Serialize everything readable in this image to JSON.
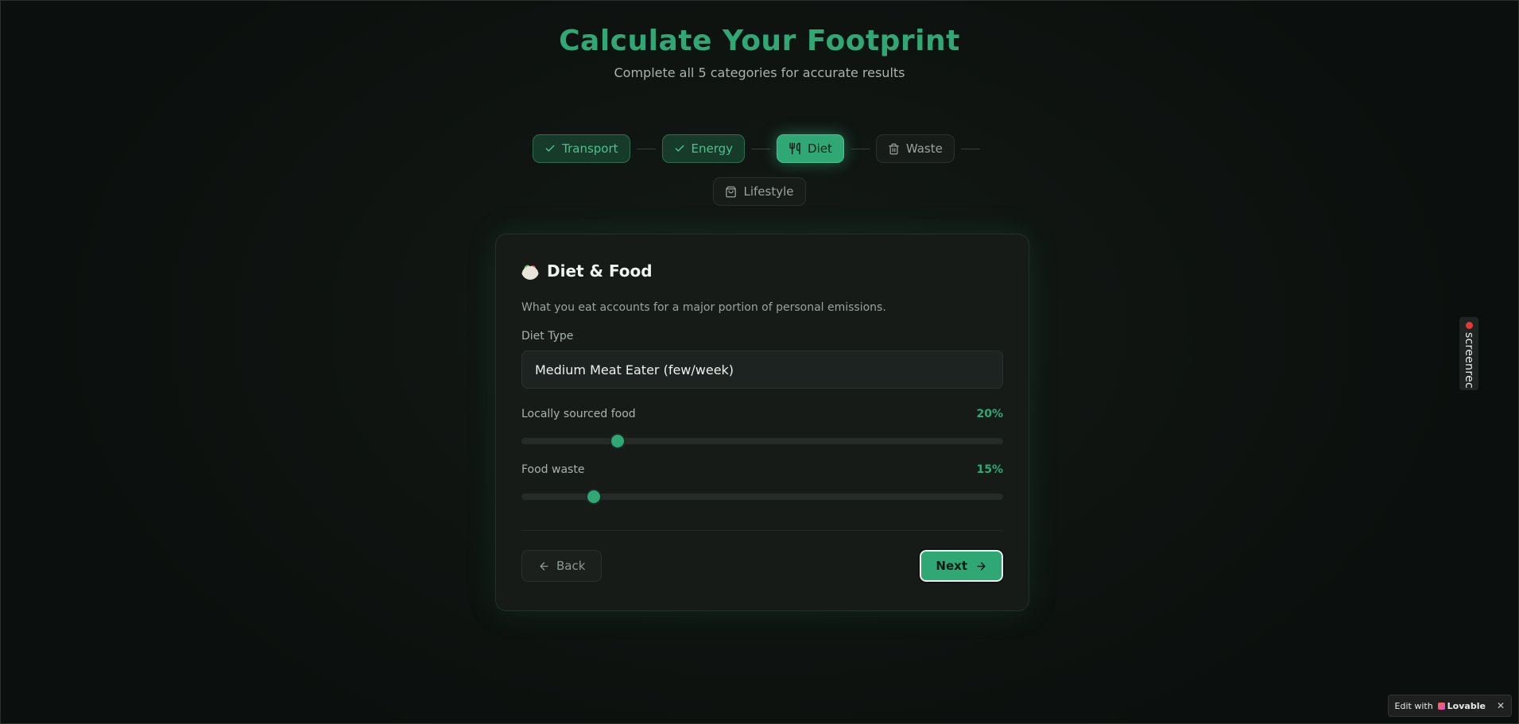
{
  "header": {
    "title": "Calculate Your Footprint",
    "subtitle": "Complete all 5 categories for accurate results"
  },
  "steps": [
    {
      "label": "Transport",
      "state": "done",
      "icon": "check-icon"
    },
    {
      "label": "Energy",
      "state": "done",
      "icon": "check-icon"
    },
    {
      "label": "Diet",
      "state": "active",
      "icon": "utensils-icon"
    },
    {
      "label": "Waste",
      "state": "pending",
      "icon": "trash-icon"
    },
    {
      "label": "Lifestyle",
      "state": "pending",
      "icon": "shopping-bag-icon"
    }
  ],
  "card": {
    "emoji_icon": "salad-bowl-icon",
    "title": "Diet & Food",
    "description": "What you eat accounts for a major portion of personal emissions.",
    "diet_type": {
      "label": "Diet Type",
      "value": "Medium Meat Eater (few/week)"
    },
    "local_food": {
      "label": "Locally sourced food",
      "value_text": "20%",
      "value": 20
    },
    "food_waste": {
      "label": "Food waste",
      "value_text": "15%",
      "value": 15
    },
    "back_label": "Back",
    "next_label": "Next"
  },
  "overlays": {
    "screenrec_label": "screenrec",
    "lovable_prefix": "Edit with",
    "lovable_brand": "Lovable",
    "close_glyph": "✕"
  },
  "colors": {
    "accent": "#2fa876",
    "background": "#0f1411",
    "card": "#161b18"
  }
}
